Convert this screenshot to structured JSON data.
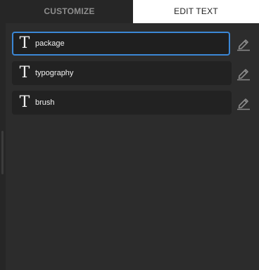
{
  "tabs": {
    "customize": "CUSTOMIZE",
    "edit_text": "EDIT TEXT"
  },
  "text_items": [
    {
      "label": "package",
      "selected": true
    },
    {
      "label": "typography",
      "selected": false
    },
    {
      "label": "brush",
      "selected": false
    }
  ],
  "icons": {
    "text": "T",
    "edit": "pencil-icon"
  },
  "colors": {
    "panel_bg": "#2c2c2c",
    "item_bg": "#222222",
    "selected_border": "#3b87d6",
    "active_tab_bg": "#ffffff",
    "inactive_tab_text": "#8e8e8e"
  }
}
